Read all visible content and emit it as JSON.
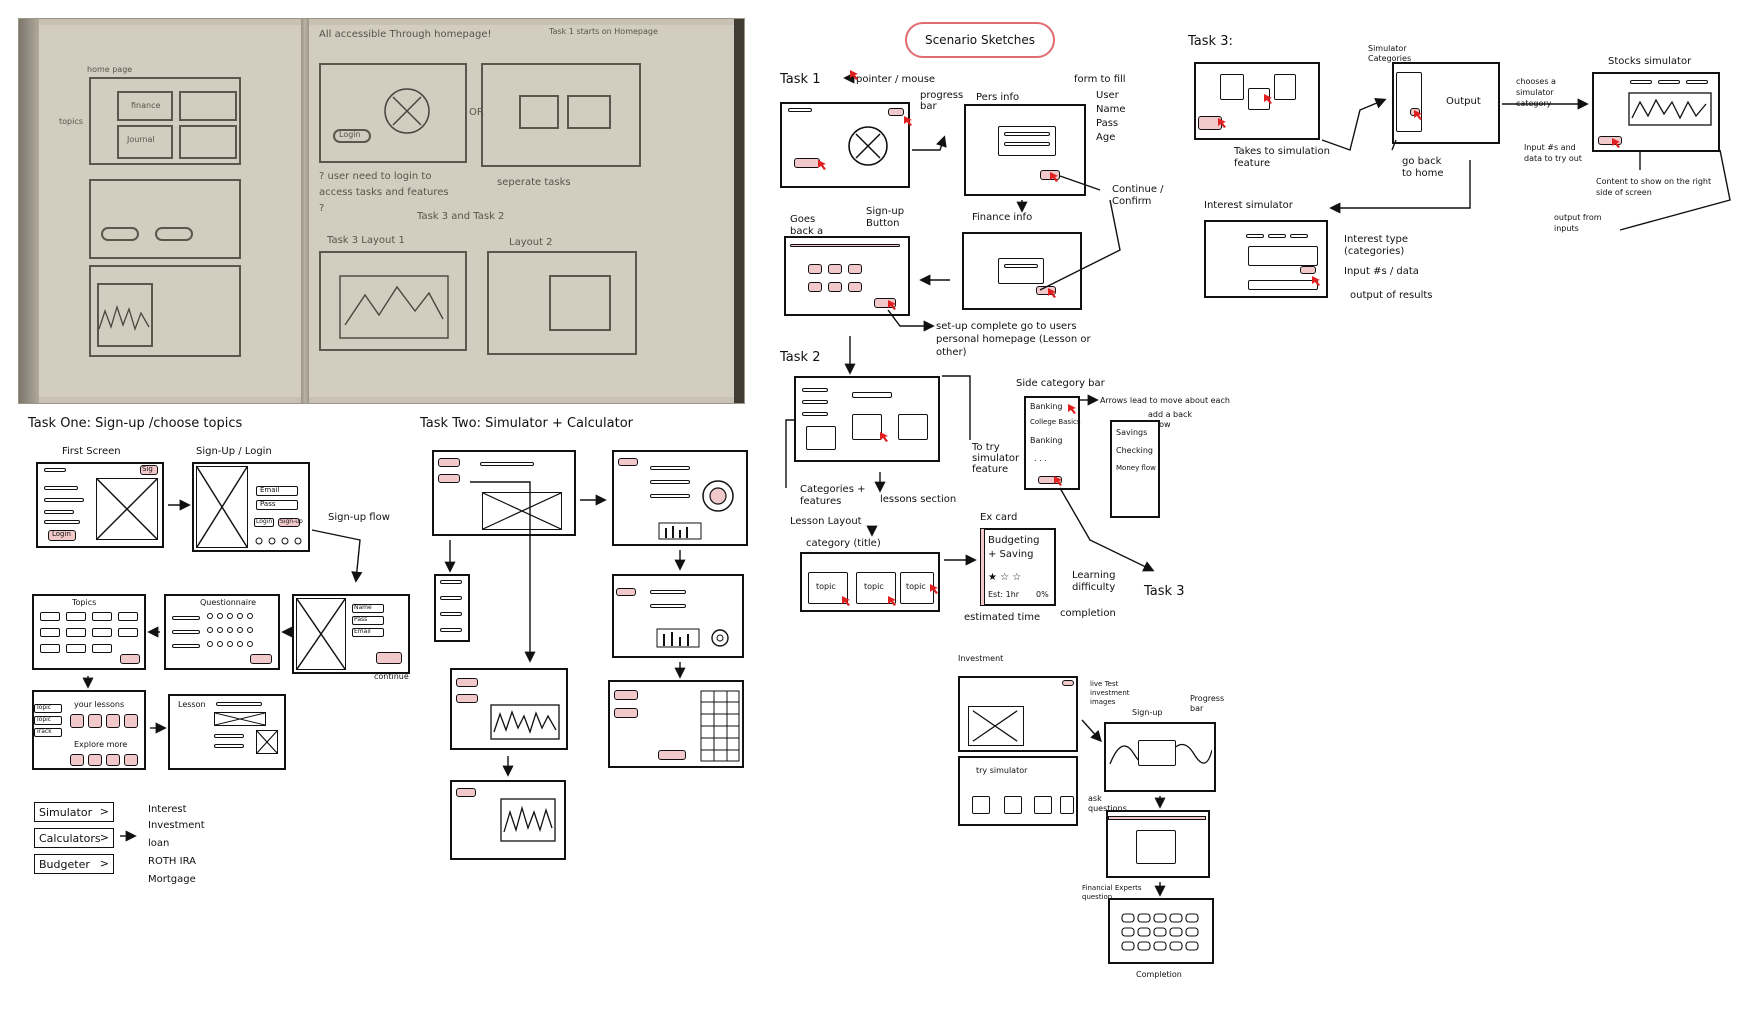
{
  "accent_color": "#f2c9cb",
  "title_color": "#e06c72",
  "title": "Scenario Sketches",
  "photo": {
    "notes": {
      "accessible": "All accessible Through homepage!",
      "task1_starts": "Task 1 starts on Homepage",
      "login": "Login",
      "or": "OR",
      "separate_tasks": "seperate tasks",
      "question": "? user need to login to access tasks and features ?",
      "task3_task2": "Task 3 and Task 2",
      "task3_layout1": "Task 3 Layout 1",
      "layout2": "Layout 2",
      "topics": "topics",
      "home_page": "home page",
      "journal": "Journal",
      "finance": "finance"
    }
  },
  "task_one": {
    "heading": "Task One: Sign-up /choose topics",
    "first_screen": "First Screen",
    "signup_login": "Sign-Up / Login",
    "signup_flow": "Sign-up flow",
    "topics": "Topics",
    "questionnaire": "Questionnaire",
    "continue": "continue",
    "your_lessons": "your lessons",
    "explore_more": "Explore more",
    "lesson": "Lesson",
    "login_btn": "Login",
    "signup_btn": "Sign-up",
    "email": "Email",
    "pass": "Pass",
    "name": "Name",
    "sig": "Sig",
    "nav_items": [
      "Simulator",
      "Calculators",
      "Budgeter"
    ],
    "calc_list": [
      "Interest",
      "Investment",
      "loan",
      "ROTH IRA",
      "Mortgage"
    ],
    "side_items": [
      "Topic",
      "Topic",
      "Track"
    ]
  },
  "task_two": {
    "heading": "Task Two: Simulator + Calculator"
  },
  "task1_scenario": {
    "label": "Task 1",
    "pointer": "pointer / mouse",
    "progress_bar": "progress bar",
    "pers_info": "Pers info",
    "form_to_fill": "form to fill",
    "form_fields": [
      "User",
      "Name",
      "Pass",
      "Age"
    ],
    "continue_confirm": "Continue / Confirm",
    "goes_back": "Goes back a step",
    "signup_button": "Sign-up Button",
    "finance_info": "Finance info",
    "setup_complete": "set-up complete go to users personal homepage (Lesson or other)"
  },
  "task2_scenario": {
    "label": "Task 2",
    "categories_features": "Categories + features",
    "lessons_section": "lessons section",
    "lesson_layout": "Lesson Layout",
    "category_title": "category (title)",
    "topic": "topic",
    "to_try_simulator": "To try simulator feature",
    "side_category_bar": "Side category bar",
    "side_items": [
      "Banking",
      "College Basics",
      "Banking",
      ". . ."
    ],
    "side_items2": [
      "Savings",
      "Checking",
      "Money flow"
    ],
    "arrows_lead": "Arrows lead to move about each",
    "add_back_arrow": "add a back arrow",
    "ex_card": "Ex card",
    "card_title": "Budgeting + Saving",
    "card_est": "Est: 1hr",
    "card_pct": "0%",
    "learning_difficulty": "Learning difficulty",
    "estimated_time": "estimated time",
    "completion": "completion",
    "task3": "Task 3"
  },
  "task3_scenario": {
    "label": "Task 3:",
    "simulator_categories": "Simulator Categories",
    "output": "Output",
    "chooses_category": "chooses a simulator category",
    "stocks_simulator": "Stocks simulator",
    "takes_to_sim": "Takes to simulation feature",
    "go_back_home": "go back to home",
    "input_data": "Input #s and data to try out",
    "content_right": "Content to show on the right side of screen",
    "output_from_inputs": "output from inputs",
    "interest_simulator": "Interest simulator",
    "interest_type": "Interest type (categories)",
    "input_data2": "Input #s / data",
    "output_results": "output of results"
  },
  "investment": {
    "label": "Investment",
    "live_investment": "live Test investment images",
    "signup": "Sign-up",
    "progress_bar": "Progress bar",
    "try_simulator": "try simulator",
    "ask_questions": "ask questions",
    "financial_question": "Financial Experts question",
    "completion": "Completion"
  }
}
